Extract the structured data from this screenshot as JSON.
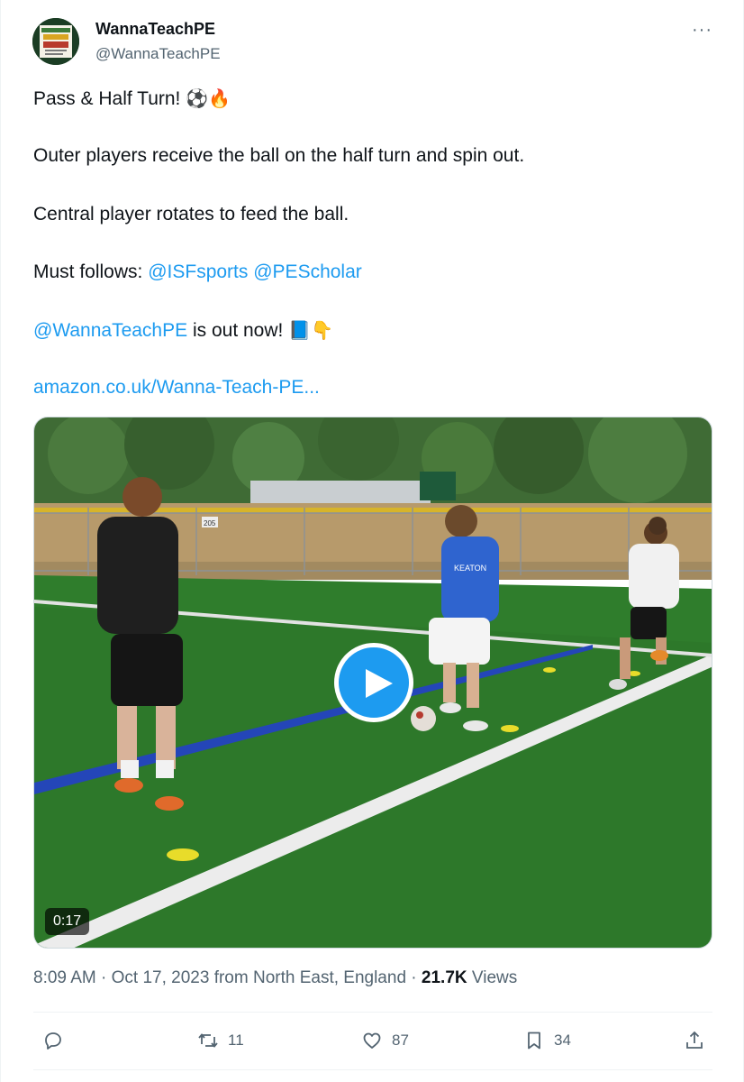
{
  "tweet": {
    "author": {
      "display_name": "WannaTeachPE",
      "handle": "@WannaTeachPE",
      "avatar_text": "WANNA TEACH PE?"
    },
    "more_label": "···",
    "lines": {
      "title": "Pass & Half Turn! ",
      "title_emojis": "⚽🔥",
      "line2": "Outer players receive the ball on the half turn and spin out.",
      "line3": "Central player rotates to feed the ball.",
      "must_follows_label": "Must follows: ",
      "mention1": "@ISFsports",
      "mention2": "@PEScholar",
      "mention3": "@WannaTeachPE",
      "out_now": " is out now! ",
      "out_now_emojis": "📘👇",
      "url": "amazon.co.uk/Wanna-Teach-PE..."
    },
    "media": {
      "duration": "0:17",
      "shirt_text": "KEATON",
      "scoreboard_sign": "205"
    },
    "meta": {
      "time": "8:09 AM",
      "date": "Oct 17, 2023",
      "location": "from North East, England",
      "views_count": "21.7K",
      "views_label": "Views",
      "sep": " · "
    },
    "actions": {
      "replies": "",
      "reposts": "11",
      "likes": "87",
      "bookmarks": "34"
    }
  },
  "icons": [
    "reply-icon",
    "repost-icon",
    "like-icon",
    "bookmark-icon",
    "share-icon",
    "play-icon",
    "more-icon"
  ],
  "colors": {
    "link": "#1d9bf0",
    "secondary_text": "#536471",
    "play_button": "#1d9bf0",
    "field_green": "#2f7d2c"
  }
}
